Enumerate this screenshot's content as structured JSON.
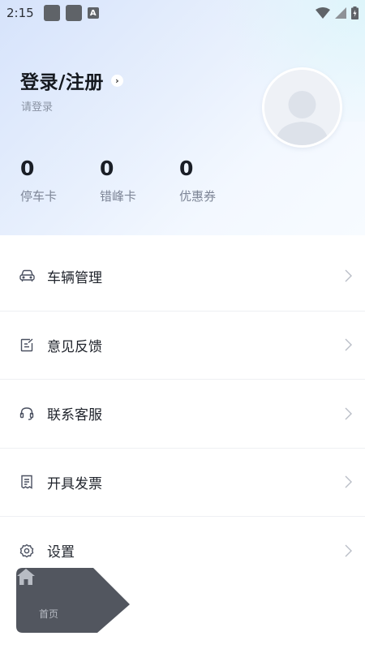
{
  "status_bar": {
    "time": "2:15",
    "notification_icon": "A"
  },
  "profile": {
    "login_title": "登录/注册",
    "login_subtitle": "请登录"
  },
  "stats": [
    {
      "value": "0",
      "label": "停车卡"
    },
    {
      "value": "0",
      "label": "错峰卡"
    },
    {
      "value": "0",
      "label": "优惠券"
    }
  ],
  "menu": [
    {
      "label": "车辆管理",
      "icon": "car-icon"
    },
    {
      "label": "意见反馈",
      "icon": "feedback-icon"
    },
    {
      "label": "联系客服",
      "icon": "headset-icon"
    },
    {
      "label": "开具发票",
      "icon": "invoice-icon"
    },
    {
      "label": "设置",
      "icon": "gear-icon"
    }
  ],
  "floating_tab": {
    "label": "首页",
    "icon": "home-icon"
  }
}
